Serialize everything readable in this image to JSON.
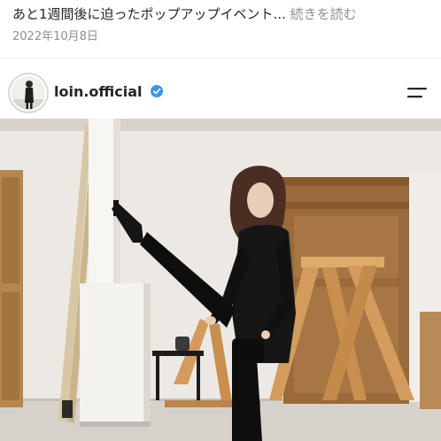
{
  "caption": {
    "text": "あと1週間後に迫ったポップアップイベント...",
    "more_label": "続きを読む"
  },
  "post_date": "2022年10月8日",
  "account": {
    "username": "loin.official",
    "verified": true
  },
  "icons": {
    "verified": "verified-badge-icon",
    "menu": "menu-icon"
  },
  "colors": {
    "text": "#262626",
    "muted": "#8e8e8e",
    "verified_blue": "#3897f0"
  }
}
